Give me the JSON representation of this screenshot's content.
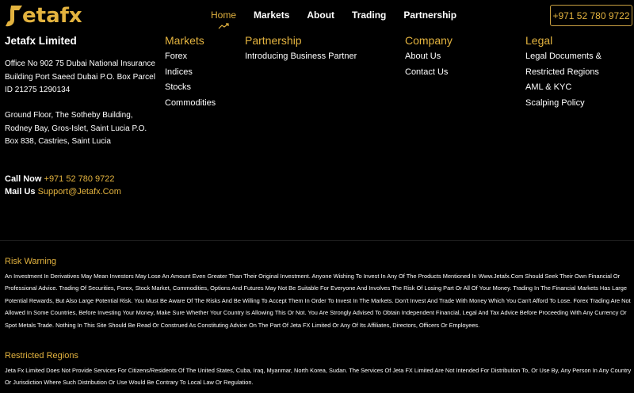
{
  "header": {
    "logo_text": "etafx",
    "nav": [
      {
        "label": "Home"
      },
      {
        "label": "Markets"
      },
      {
        "label": "About"
      },
      {
        "label": "Trading"
      },
      {
        "label": "Partnership"
      }
    ],
    "phone_button": "+971 52 780 9722"
  },
  "company": {
    "name_prefix": "Jetafx",
    "name_suffix": " Limited",
    "address1": "Office No 902 75 Dubai National Insurance Building Port Saeed Dubai P.O. Box Parcel ID 21275 1290134",
    "address2": "Ground Floor, The Sotheby Building, Rodney Bay, Gros-Islet, Saint Lucia P.O. Box 838, Castries, Saint Lucia",
    "call_label": "Call Now",
    "call_value": "+971 52 780 9722",
    "mail_label": "Mail Us",
    "mail_value": "Support@Jetafx.Com"
  },
  "columns": {
    "markets": {
      "title": "Markets",
      "links": [
        "Forex",
        "Indices",
        "Stocks",
        "Commodities"
      ]
    },
    "partnership": {
      "title": "Partnership",
      "links": [
        "Introducing Business Partner"
      ]
    },
    "company": {
      "title": "Company",
      "links": [
        "About Us",
        "Contact Us"
      ]
    },
    "legal": {
      "title": "Legal",
      "links": [
        "Legal Documents &",
        "Restricted Regions",
        "AML & KYC",
        "Scalping Policy"
      ]
    }
  },
  "risk": {
    "title": "Risk Warning",
    "text": "An Investment In Derivatives May Mean Investors May Lose An Amount Even Greater Than Their Original Investment. Anyone Wishing To Invest In Any Of The Products Mentioned In Www.Jetafx.Com Should Seek Their Own Financial Or Professional Advice. Trading Of Securities, Forex, Stock Market, Commodities, Options And Futures May Not Be Suitable For Everyone And Involves The Risk Of Losing Part Or All Of Your Money. Trading In The Financial Markets Has Large Potential Rewards, But Also Large Potential Risk. You Must Be Aware Of The Risks And Be Willing To Accept Them In Order To Invest In The Markets. Don't Invest And Trade With Money Which You Can't Afford To Lose. Forex Trading Are Not Allowed In Some Countries, Before Investing Your Money, Make Sure Whether Your Country Is Allowing This Or Not. You Are Strongly Advised To Obtain Independent Financial, Legal And Tax Advice Before Proceeding With Any Currency Or Spot Metals Trade. Nothing In This Site Should Be Read Or Construed As Constituting Advice On The Part Of Jeta FX Limited Or Any Of Its Affiliates, Directors, Officers Or Employees."
  },
  "restricted": {
    "title": "Restricted Regions",
    "text": "Jeta Fx Limited Does Not Provide Services For Citizens/Residents Of The United States, Cuba, Iraq, Myanmar, North Korea, Sudan. The Services Of Jeta FX Limited Are Not Intended For Distribution To, Or Use By, Any Person In Any Country Or Jurisdiction Where Such Distribution Or Use Would Be Contrary To Local Law Or Regulation."
  },
  "colors": {
    "accent": "#e3b33f",
    "background": "#000000",
    "text": "#ffffff"
  }
}
